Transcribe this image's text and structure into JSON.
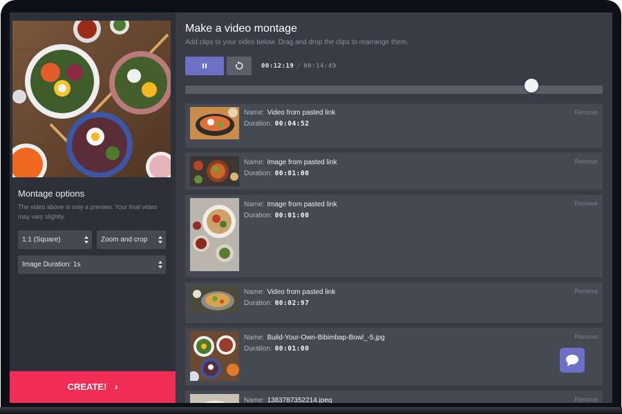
{
  "sidebar": {
    "options_title": "Montage options",
    "options_note": "The video above is only a preview. Your final video may vary slightly.",
    "aspect_select": "1:1 (Square)",
    "crop_select": "Zoom and crop",
    "duration_select": "Image Duration: 1s",
    "create_label": "CREATE!"
  },
  "main": {
    "title": "Make a video montage",
    "subtitle": "Add clips to your video below. Drag and drop the clips to rearrange them.",
    "current_time": "00:12:19",
    "time_separator": "/",
    "total_time": "00:14:49",
    "scrubber_progress": 0.83
  },
  "clips": [
    {
      "name_label": "Name:",
      "name": "Video from pasted link",
      "duration_label": "Duration:",
      "duration": "00:04:52",
      "remove": "Remove"
    },
    {
      "name_label": "Name:",
      "name": "Image from pasted link",
      "duration_label": "Duration:",
      "duration": "00:01:00",
      "remove": "Remove"
    },
    {
      "name_label": "Name:",
      "name": "Image from pasted link",
      "duration_label": "Duration:",
      "duration": "00:01:00",
      "remove": "Remove"
    },
    {
      "name_label": "Name:",
      "name": "Video from pasted link",
      "duration_label": "Duration:",
      "duration": "00:02:97",
      "remove": "Remove"
    },
    {
      "name_label": "Name:",
      "name": "Build-Your-Own-Bibimbap-Bowl_-5.jpg",
      "duration_label": "Duration:",
      "duration": "00:01:00",
      "remove": "Remove"
    },
    {
      "name_label": "Name:",
      "name": "1383787352214.jpeg",
      "duration_label": "",
      "duration": "",
      "remove": "Remove"
    }
  ],
  "colors": {
    "accent": "#6c70c7",
    "create": "#ef2d55",
    "panel": "#2d3039",
    "card": "#454954"
  }
}
